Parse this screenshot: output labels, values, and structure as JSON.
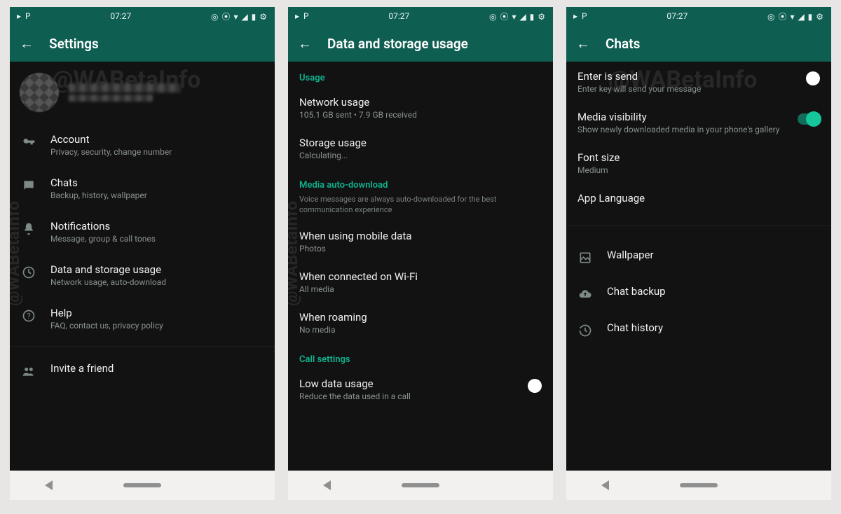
{
  "statusbar": {
    "time": "07:27"
  },
  "watermark": "@WABetaInfo",
  "screen1": {
    "title": "Settings",
    "items": [
      {
        "icon": "key-icon",
        "title": "Account",
        "sub": "Privacy, security, change number"
      },
      {
        "icon": "chat-icon",
        "title": "Chats",
        "sub": "Backup, history, wallpaper"
      },
      {
        "icon": "bell-icon",
        "title": "Notifications",
        "sub": "Message, group & call tones"
      },
      {
        "icon": "data-icon",
        "title": "Data and storage usage",
        "sub": "Network usage, auto-download"
      },
      {
        "icon": "help-icon",
        "title": "Help",
        "sub": "FAQ, contact us, privacy policy"
      }
    ],
    "invite": {
      "title": "Invite a friend"
    }
  },
  "screen2": {
    "title": "Data and storage usage",
    "usage_header": "Usage",
    "network": {
      "title": "Network usage",
      "sub": "105.1 GB sent • 7.9 GB received"
    },
    "storage": {
      "title": "Storage usage",
      "sub": "Calculating..."
    },
    "media_header": "Media auto-download",
    "media_note": "Voice messages are always auto-downloaded for the best communication experience",
    "mobile": {
      "title": "When using mobile data",
      "sub": "Photos"
    },
    "wifi": {
      "title": "When connected on Wi-Fi",
      "sub": "All media"
    },
    "roaming": {
      "title": "When roaming",
      "sub": "No media"
    },
    "call_header": "Call settings",
    "lowdata": {
      "title": "Low data usage",
      "sub": "Reduce the data used in a call"
    }
  },
  "screen3": {
    "title": "Chats",
    "enter": {
      "title": "Enter is send",
      "sub": "Enter key will send your message"
    },
    "media": {
      "title": "Media visibility",
      "sub": "Show newly downloaded media in your phone's gallery"
    },
    "font": {
      "title": "Font size",
      "sub": "Medium"
    },
    "lang": {
      "title": "App Language"
    },
    "wallpaper": {
      "title": "Wallpaper"
    },
    "backup": {
      "title": "Chat backup"
    },
    "history": {
      "title": "Chat history"
    }
  }
}
